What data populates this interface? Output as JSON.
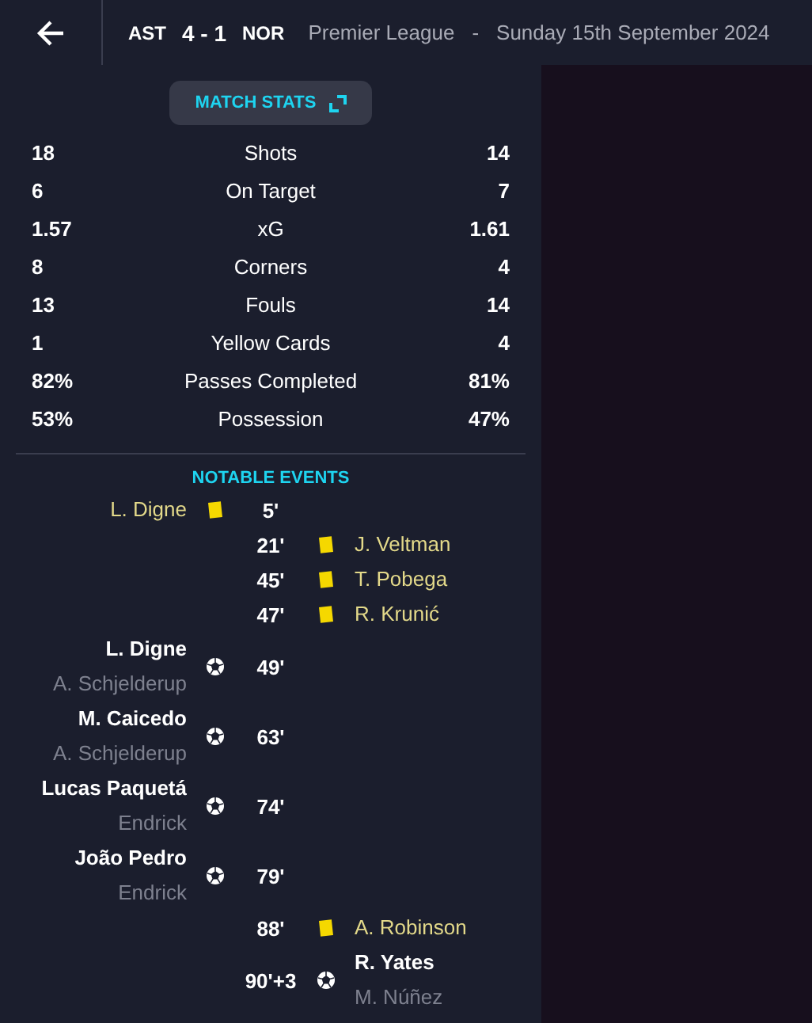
{
  "header": {
    "home": "AST",
    "score": "4 - 1",
    "away": "NOR",
    "competition": "Premier League",
    "separator": "-",
    "date": "Sunday 15th September 2024"
  },
  "match_stats_button": "MATCH STATS",
  "stats": [
    {
      "home": "18",
      "label": "Shots",
      "away": "14"
    },
    {
      "home": "6",
      "label": "On Target",
      "away": "7"
    },
    {
      "home": "1.57",
      "label": "xG",
      "away": "1.61"
    },
    {
      "home": "8",
      "label": "Corners",
      "away": "4"
    },
    {
      "home": "13",
      "label": "Fouls",
      "away": "14"
    },
    {
      "home": "1",
      "label": "Yellow Cards",
      "away": "4"
    },
    {
      "home": "82%",
      "label": "Passes Completed",
      "away": "81%"
    },
    {
      "home": "53%",
      "label": "Possession",
      "away": "47%"
    }
  ],
  "events_title": "NOTABLE EVENTS",
  "events": [
    {
      "away_team": false,
      "kind": "card",
      "player": "L. Digne",
      "minute": "5'"
    },
    {
      "away_team": true,
      "kind": "card",
      "player": "J. Veltman",
      "minute": "21'"
    },
    {
      "away_team": true,
      "kind": "card",
      "player": "T. Pobega",
      "minute": "45'"
    },
    {
      "away_team": true,
      "kind": "card",
      "player": "R. Krunić",
      "minute": "47'"
    },
    {
      "away_team": false,
      "kind": "goal",
      "player": "L. Digne",
      "assist": "A. Schjelderup",
      "minute": "49'"
    },
    {
      "away_team": false,
      "kind": "goal",
      "player": "M. Caicedo",
      "assist": "A. Schjelderup",
      "minute": "63'"
    },
    {
      "away_team": false,
      "kind": "goal",
      "player": "Lucas Paquetá",
      "assist": "Endrick",
      "minute": "74'"
    },
    {
      "away_team": false,
      "kind": "goal",
      "player": "João Pedro",
      "assist": "Endrick",
      "minute": "79'"
    },
    {
      "away_team": true,
      "kind": "card",
      "player": "A. Robinson",
      "minute": "88'"
    },
    {
      "away_team": true,
      "kind": "goal",
      "player": "R. Yates",
      "assist": "M. Núñez",
      "minute": "90'+3"
    }
  ]
}
